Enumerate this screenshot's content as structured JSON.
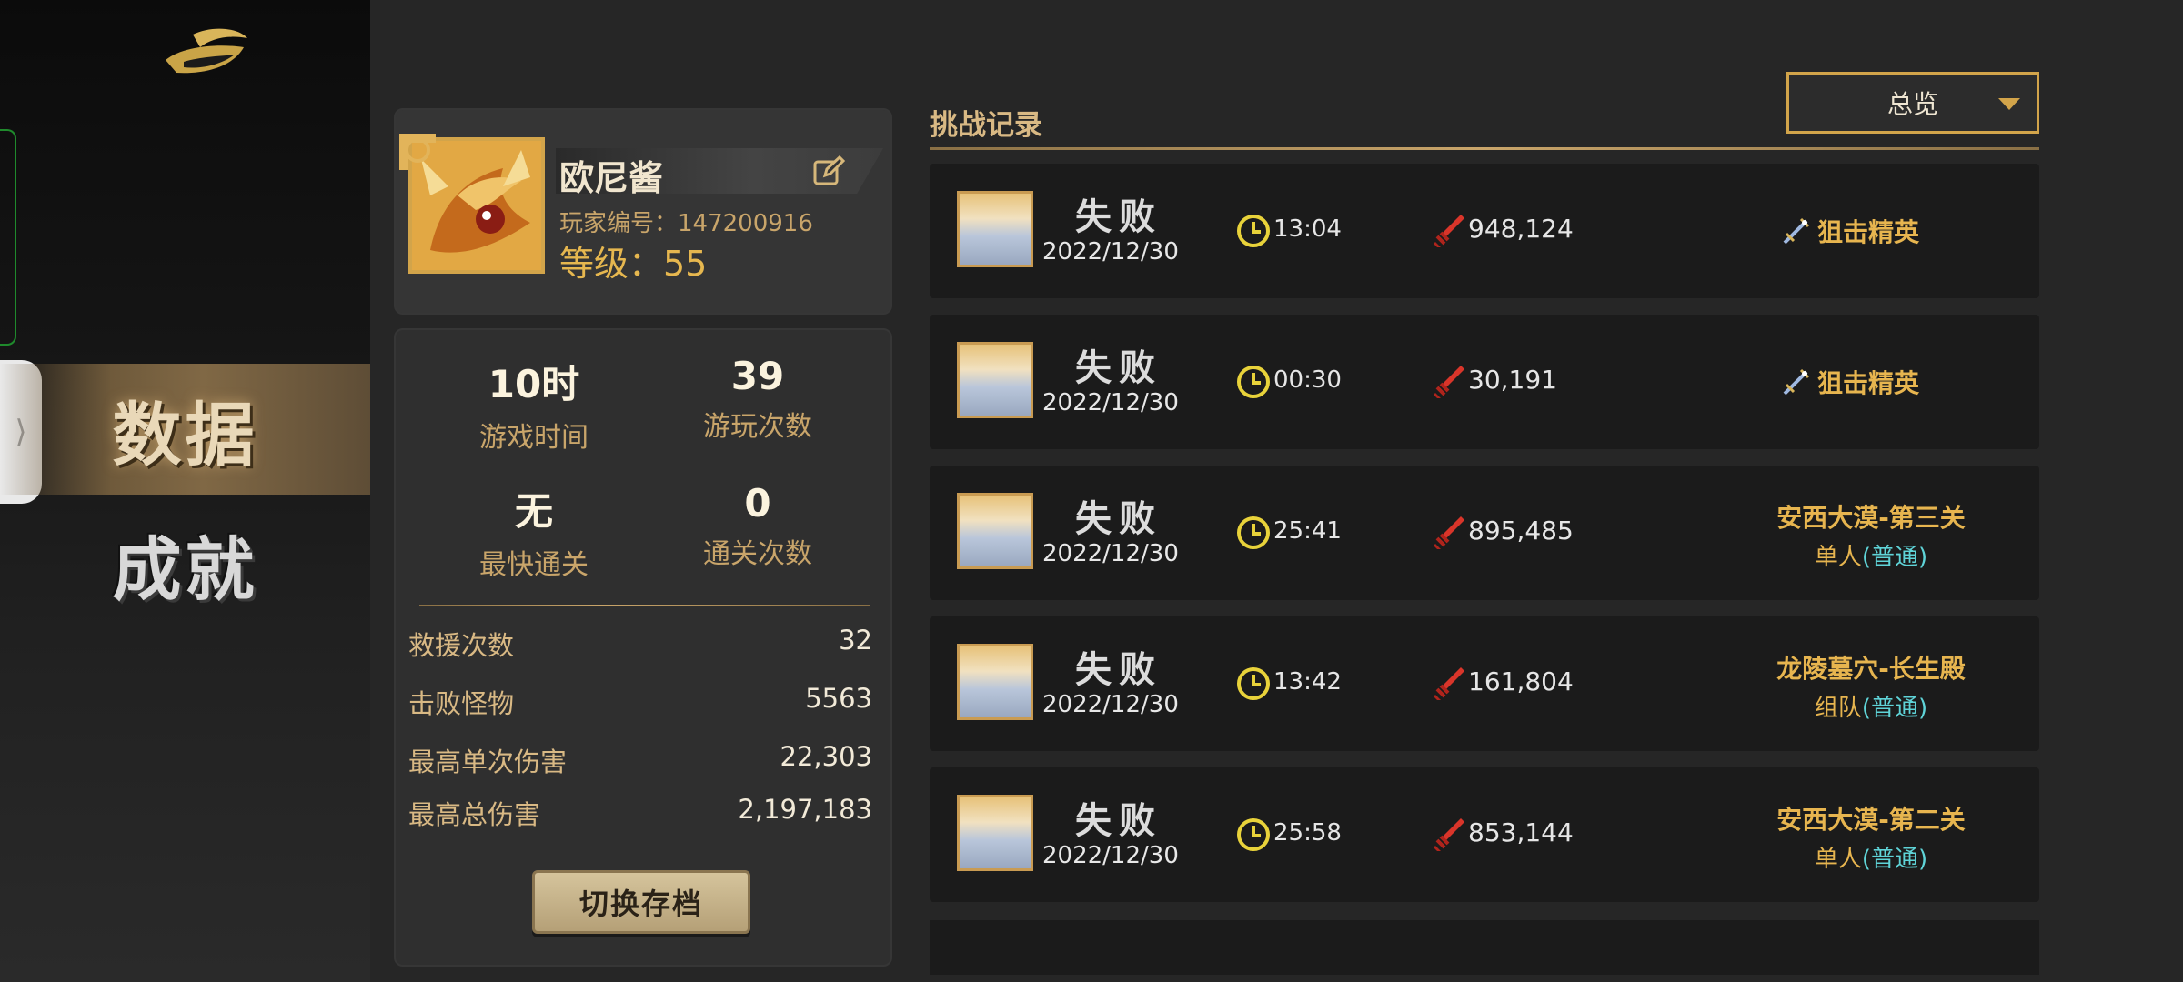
{
  "sidebar": {
    "tab_handle": "⟩",
    "nav": [
      {
        "label": "数据",
        "active": true
      },
      {
        "label": "成就",
        "active": false
      }
    ]
  },
  "profile": {
    "name": "欧尼酱",
    "player_id": "玩家编号：147200916",
    "level": "等级：55",
    "edit_icon": "edit-icon"
  },
  "stats": {
    "play_time": {
      "value": "10时",
      "label": "游戏时间"
    },
    "play_count": {
      "value": "39",
      "label": "游玩次数"
    },
    "fastest_clear": {
      "value": "无",
      "label": "最快通关"
    },
    "clear_count": {
      "value": "0",
      "label": "通关次数"
    },
    "rows": [
      {
        "label": "救援次数",
        "value": "32"
      },
      {
        "label": "击败怪物",
        "value": "5563"
      },
      {
        "label": "最高单次伤害",
        "value": "22,303"
      },
      {
        "label": "最高总伤害",
        "value": "2,197,183"
      }
    ],
    "switch_button": "切换存档"
  },
  "records": {
    "title": "挑战记录",
    "filter": "总览",
    "items": [
      {
        "result": "失败",
        "date": "2022/12/30",
        "time": "13:04",
        "damage": "948,124",
        "type": "elite",
        "label": "狙击精英"
      },
      {
        "result": "失败",
        "date": "2022/12/30",
        "time": "00:30",
        "damage": "30,191",
        "type": "elite",
        "label": "狙击精英"
      },
      {
        "result": "失败",
        "date": "2022/12/30",
        "time": "25:41",
        "damage": "895,485",
        "type": "stage",
        "stage": "安西大漠-第三关",
        "mode": "单人",
        "difficulty": "(普通)"
      },
      {
        "result": "失败",
        "date": "2022/12/30",
        "time": "13:42",
        "damage": "161,804",
        "type": "stage",
        "stage": "龙陵墓穴-长生殿",
        "mode": "组队",
        "difficulty": "(普通)"
      },
      {
        "result": "失败",
        "date": "2022/12/30",
        "time": "25:58",
        "damage": "853,144",
        "type": "stage",
        "stage": "安西大漠-第二关",
        "mode": "单人",
        "difficulty": "(普通)"
      }
    ]
  },
  "colors": {
    "gold": "#e7b54f",
    "cyan_difficulty": "#5fd4d8",
    "panel_bg": "#303030",
    "record_bg": "#1b1b1b"
  }
}
